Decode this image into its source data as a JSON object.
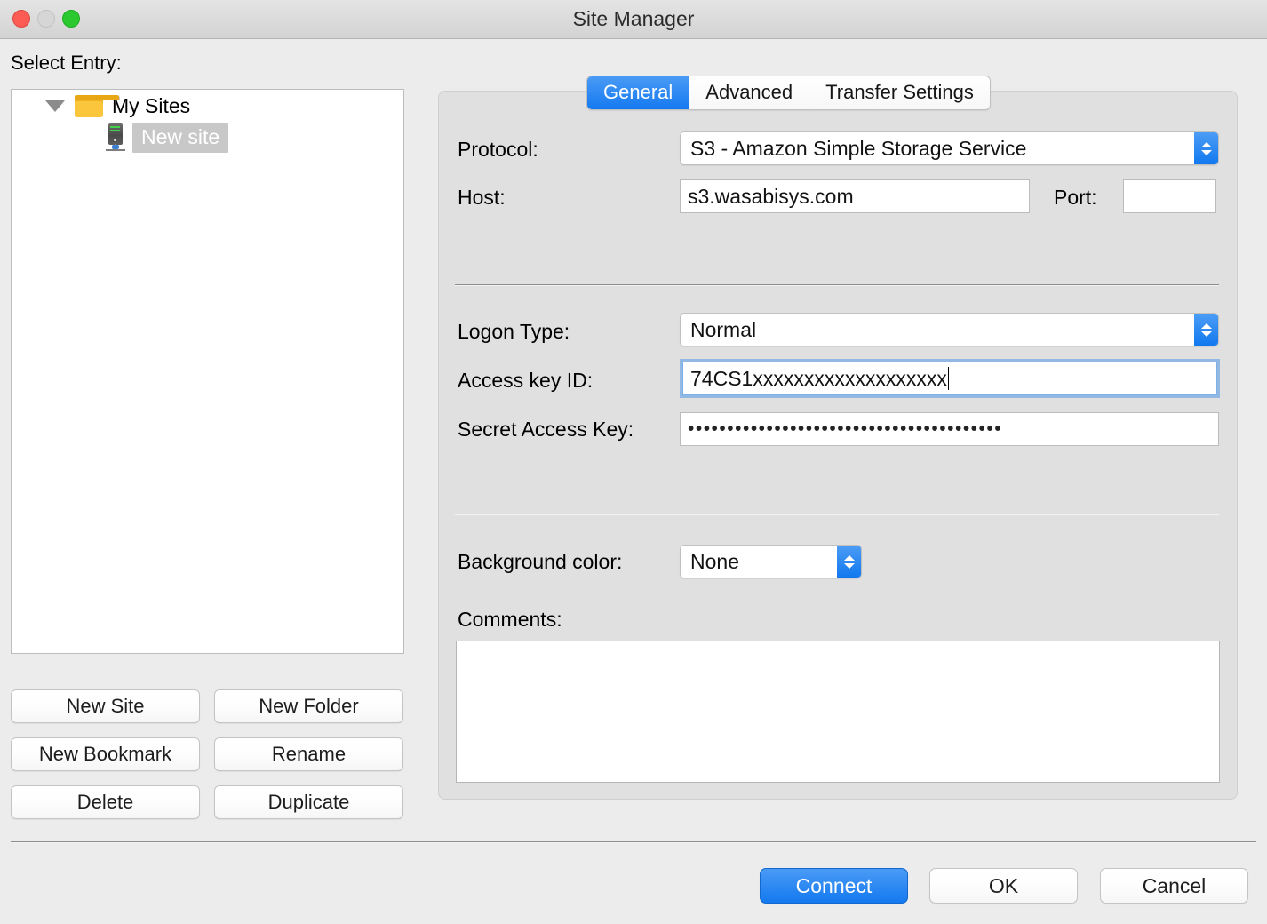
{
  "window": {
    "title": "Site Manager",
    "traffic_lights": [
      {
        "name": "close",
        "color": "#fc5c54"
      },
      {
        "name": "minimize",
        "color": "#d6d6d6"
      },
      {
        "name": "zoom",
        "color": "#2bc82f"
      }
    ]
  },
  "sidebar": {
    "label": "Select Entry:",
    "tree": {
      "root": {
        "label": "My Sites",
        "icon": "folder-icon",
        "expanded": true
      },
      "children": [
        {
          "label": "New site",
          "icon": "server-icon",
          "selected": true
        }
      ]
    },
    "buttons": [
      {
        "id": "new-site",
        "label": "New Site"
      },
      {
        "id": "new-folder",
        "label": "New Folder"
      },
      {
        "id": "new-bookmark",
        "label": "New Bookmark"
      },
      {
        "id": "rename",
        "label": "Rename"
      },
      {
        "id": "delete",
        "label": "Delete"
      },
      {
        "id": "duplicate",
        "label": "Duplicate"
      }
    ]
  },
  "tabs": [
    {
      "id": "general",
      "label": "General",
      "active": true
    },
    {
      "id": "advanced",
      "label": "Advanced",
      "active": false
    },
    {
      "id": "transfer-settings",
      "label": "Transfer Settings",
      "active": false
    }
  ],
  "general": {
    "protocol": {
      "label": "Protocol:",
      "value": "S3 - Amazon Simple Storage Service"
    },
    "host": {
      "label": "Host:",
      "value": "s3.wasabisys.com"
    },
    "port": {
      "label": "Port:",
      "value": ""
    },
    "logon_type": {
      "label": "Logon Type:",
      "value": "Normal"
    },
    "access_key_id": {
      "label": "Access key ID:",
      "value": "74CS1xxxxxxxxxxxxxxxxxxx",
      "focused": true
    },
    "secret_access_key": {
      "label": "Secret Access Key:",
      "value": "••••••••••••••••••••••••••••••••••••••••"
    },
    "background_color": {
      "label": "Background color:",
      "value": "None"
    },
    "comments": {
      "label": "Comments:",
      "value": ""
    }
  },
  "footer": {
    "connect_label": "Connect",
    "ok_label": "OK",
    "cancel_label": "Cancel"
  },
  "colors": {
    "accent": "#1479f0",
    "window_bg": "#ececec",
    "panel_bg": "#e0e0e0",
    "selection_bg": "#c8c8c8"
  }
}
